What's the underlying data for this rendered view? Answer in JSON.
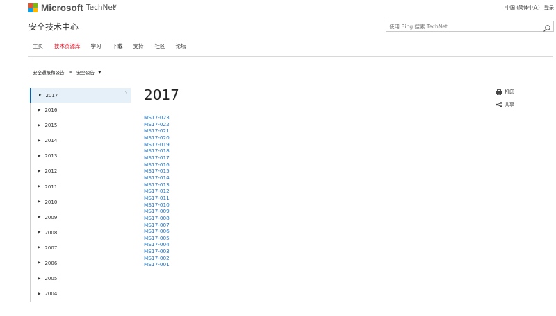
{
  "header": {
    "brand": "Microsoft",
    "section": "TechNet",
    "section_chevron": "∨",
    "locale": "中国 (简体中文)",
    "signin": "登录",
    "logo_colors": [
      "#f25022",
      "#7fba00",
      "#00a4ef",
      "#ffb900"
    ]
  },
  "site": {
    "title": "安全技术中心"
  },
  "search": {
    "placeholder": "使用 Bing 搜索 TechNet",
    "icon": "search-icon"
  },
  "nav": {
    "items": [
      {
        "label": "主页",
        "active": false
      },
      {
        "label": "技术资源库",
        "active": true
      },
      {
        "label": "学习",
        "active": false
      },
      {
        "label": "下载",
        "active": false
      },
      {
        "label": "支持",
        "active": false
      },
      {
        "label": "社区",
        "active": false
      },
      {
        "label": "论坛",
        "active": false
      }
    ]
  },
  "breadcrumb": {
    "items": [
      "安全通报和公告",
      "安全公告"
    ],
    "separator": ">",
    "caret": "▼"
  },
  "sidebar": {
    "collapse_icon": "‹",
    "items": [
      {
        "label": "2017",
        "selected": true
      },
      {
        "label": "2016",
        "selected": false
      },
      {
        "label": "2015",
        "selected": false
      },
      {
        "label": "2014",
        "selected": false
      },
      {
        "label": "2013",
        "selected": false
      },
      {
        "label": "2012",
        "selected": false
      },
      {
        "label": "2011",
        "selected": false
      },
      {
        "label": "2010",
        "selected": false
      },
      {
        "label": "2009",
        "selected": false
      },
      {
        "label": "2008",
        "selected": false
      },
      {
        "label": "2007",
        "selected": false
      },
      {
        "label": "2006",
        "selected": false
      },
      {
        "label": "2005",
        "selected": false
      },
      {
        "label": "2004",
        "selected": false
      }
    ]
  },
  "main": {
    "title": "2017",
    "bulletins": [
      "MS17-023",
      "MS17-022",
      "MS17-021",
      "MS17-020",
      "MS17-019",
      "MS17-018",
      "MS17-017",
      "MS17-016",
      "MS17-015",
      "MS17-014",
      "MS17-013",
      "MS17-012",
      "MS17-011",
      "MS17-010",
      "MS17-009",
      "MS17-008",
      "MS17-007",
      "MS17-006",
      "MS17-005",
      "MS17-004",
      "MS17-003",
      "MS17-002",
      "MS17-001"
    ],
    "link_color": "#1f75c7"
  },
  "actions": {
    "print": "打印",
    "share": "共享"
  }
}
